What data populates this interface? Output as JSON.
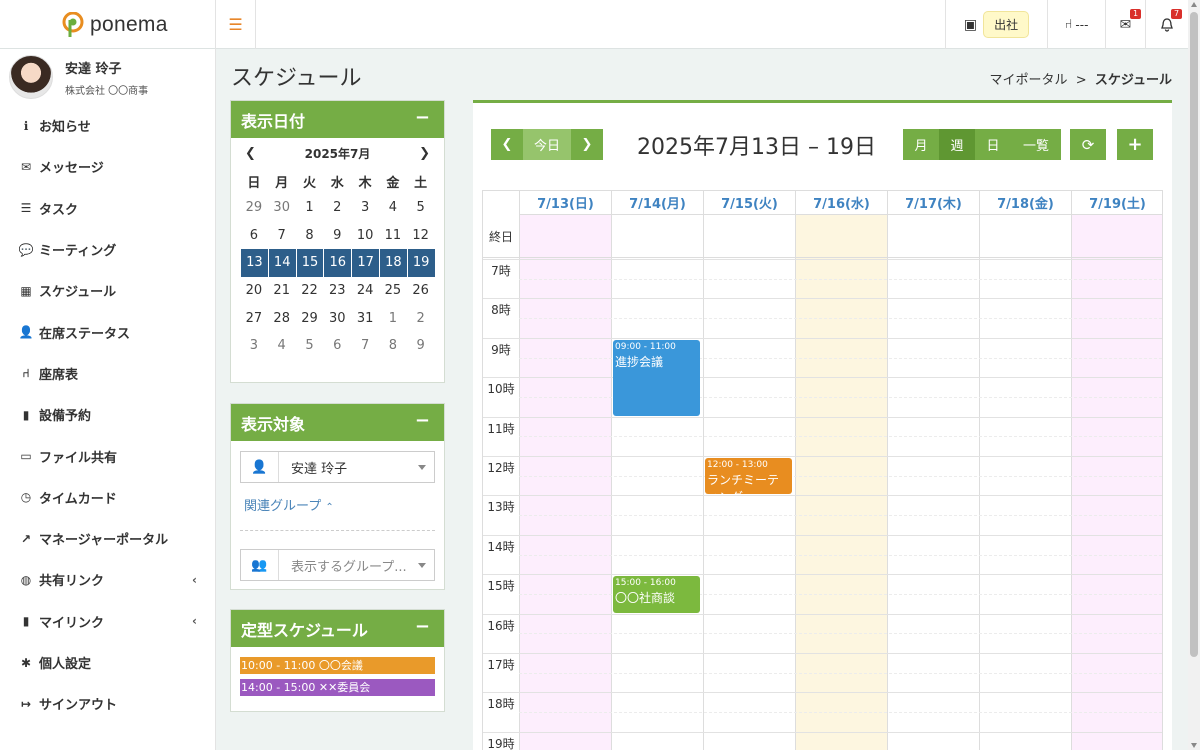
{
  "app": {
    "logo_text": "ponema"
  },
  "topbar": {
    "status_label": "出社",
    "seat_label": "---",
    "mail_badge": "1",
    "bell_badge": "7"
  },
  "user": {
    "name": "安達 玲子",
    "company": "株式会社 〇〇商事"
  },
  "sidebar": {
    "items": [
      {
        "label": "お知らせ",
        "icon": "info-icon",
        "glyph": "ℹ"
      },
      {
        "label": "メッセージ",
        "icon": "envelope-icon",
        "glyph": "✉"
      },
      {
        "label": "タスク",
        "icon": "checklist-icon",
        "glyph": "☰"
      },
      {
        "label": "ミーティング",
        "icon": "chat-icon",
        "glyph": "💬"
      },
      {
        "label": "スケジュール",
        "icon": "calendar-icon",
        "glyph": "▦"
      },
      {
        "label": "在席ステータス",
        "icon": "presence-icon",
        "glyph": "👤"
      },
      {
        "label": "座席表",
        "icon": "chair-icon",
        "glyph": "⑁"
      },
      {
        "label": "設備予約",
        "icon": "book-icon",
        "glyph": "▮"
      },
      {
        "label": "ファイル共有",
        "icon": "folder-icon",
        "glyph": "▭"
      },
      {
        "label": "タイムカード",
        "icon": "clock-icon",
        "glyph": "◷"
      },
      {
        "label": "マネージャーポータル",
        "icon": "chart-icon",
        "glyph": "↗"
      },
      {
        "label": "共有リンク",
        "icon": "globe-icon",
        "glyph": "◍",
        "chevron": "‹"
      },
      {
        "label": "マイリンク",
        "icon": "bookmark-icon",
        "glyph": "▮",
        "chevron": "‹"
      },
      {
        "label": "個人設定",
        "icon": "gear-icon",
        "glyph": "✱"
      },
      {
        "label": "サインアウト",
        "icon": "signout-icon",
        "glyph": "↦"
      }
    ]
  },
  "page": {
    "title": "スケジュール"
  },
  "breadcrumb": {
    "parent": "マイポータル",
    "sep": ">",
    "current": "スケジュール"
  },
  "date_panel": {
    "title": "表示日付",
    "month_label": "2025年7月",
    "weekdays": [
      "日",
      "月",
      "火",
      "水",
      "木",
      "金",
      "土"
    ],
    "weeks": [
      [
        "29",
        "30",
        "1",
        "2",
        "3",
        "4",
        "5"
      ],
      [
        "6",
        "7",
        "8",
        "9",
        "10",
        "11",
        "12"
      ],
      [
        "13",
        "14",
        "15",
        "16",
        "17",
        "18",
        "19"
      ],
      [
        "20",
        "21",
        "22",
        "23",
        "24",
        "25",
        "26"
      ],
      [
        "27",
        "28",
        "29",
        "30",
        "31",
        "1",
        "2"
      ],
      [
        "3",
        "4",
        "5",
        "6",
        "7",
        "8",
        "9"
      ]
    ],
    "selected_week": 2
  },
  "target_panel": {
    "title": "表示対象",
    "person": "安達 玲子",
    "related_group": "関連グループ",
    "group_placeholder": "表示するグループ..."
  },
  "fixed_panel": {
    "title": "定型スケジュール",
    "items": [
      {
        "label": "10:00 - 11:00 〇〇会議",
        "color": "#e99a2a"
      },
      {
        "label": "14:00 - 15:00 ✕✕委員会",
        "color": "#9b59c0"
      }
    ]
  },
  "calendar": {
    "today_label": "今日",
    "range_label": "2025年7月13日 – 19日",
    "views": [
      "月",
      "週",
      "日",
      "一覧"
    ],
    "active_view": "週",
    "days": [
      "7/13(日)",
      "7/14(月)",
      "7/15(火)",
      "7/16(水)",
      "7/17(木)",
      "7/18(金)",
      "7/19(土)"
    ],
    "day_bg": [
      "#fdeefd",
      "#ffffff",
      "#ffffff",
      "#fdf6e0",
      "#ffffff",
      "#ffffff",
      "#fdeefd"
    ],
    "allday_label": "終日",
    "hours": [
      "7時",
      "8時",
      "9時",
      "10時",
      "11時",
      "12時",
      "13時",
      "14時",
      "15時",
      "16時",
      "17時",
      "18時",
      "19時"
    ],
    "events": [
      {
        "day": 1,
        "start": 9,
        "end": 11,
        "time": "09:00 - 11:00",
        "title": "進捗会議",
        "color": "#3a97da"
      },
      {
        "day": 2,
        "start": 12,
        "end": 13,
        "time": "12:00 - 13:00",
        "title": "ランチミーティング",
        "color": "#e88d20"
      },
      {
        "day": 1,
        "start": 15,
        "end": 16,
        "time": "15:00 - 16:00",
        "title": "〇〇社商談",
        "color": "#7cb93e"
      }
    ]
  }
}
